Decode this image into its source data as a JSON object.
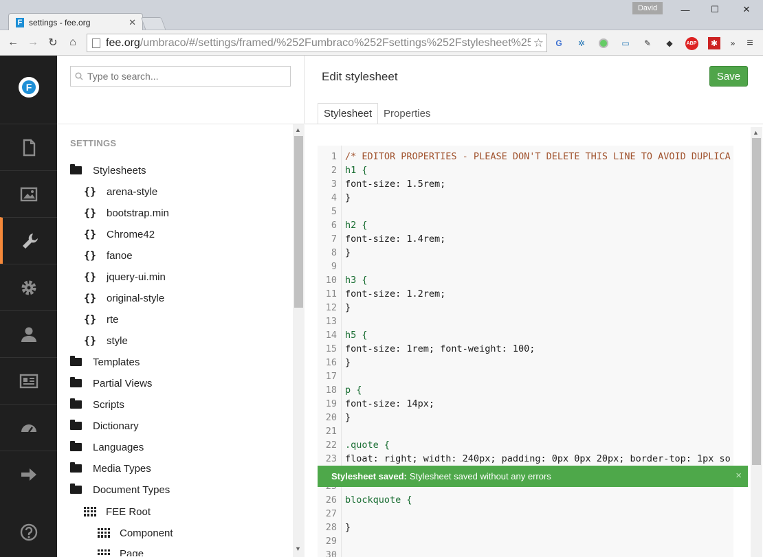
{
  "browser": {
    "tab_title": "settings - fee.org",
    "tab_favicon": "F",
    "user": "David",
    "url_host": "fee.org",
    "url_rest": "/umbraco/#/settings/framed/%252Fumbraco%252Fsettings%252Fstylesheet%252",
    "ext_abp": "ABP"
  },
  "rail": {
    "logo": "F",
    "items": [
      {
        "icon": "document-icon"
      },
      {
        "icon": "image-icon"
      },
      {
        "icon": "wrench-icon",
        "active": true
      },
      {
        "icon": "gear-icon"
      },
      {
        "icon": "user-icon"
      },
      {
        "icon": "id-card-icon"
      },
      {
        "icon": "gauge-icon"
      },
      {
        "icon": "arrow-right-icon"
      },
      {
        "icon": "help-icon"
      }
    ]
  },
  "tree": {
    "search_placeholder": "Type to search...",
    "heading": "SETTINGS",
    "stylesheets_label": "Stylesheets",
    "stylesheets": [
      "arena-style",
      "bootstrap.min",
      "Chrome42",
      "fanoe",
      "jquery-ui.min",
      "original-style",
      "rte",
      "style"
    ],
    "folders": [
      "Templates",
      "Partial Views",
      "Scripts",
      "Dictionary",
      "Languages",
      "Media Types",
      "Document Types"
    ],
    "doc_types": {
      "root": "FEE Root",
      "children": [
        "Component",
        "Page"
      ]
    }
  },
  "editor": {
    "title": "Edit stylesheet",
    "save_label": "Save",
    "tabs": [
      {
        "label": "Stylesheet",
        "active": true
      },
      {
        "label": "Properties",
        "active": false
      }
    ],
    "lines": [
      "/* EDITOR PROPERTIES - PLEASE DON'T DELETE THIS LINE TO AVOID DUPLICA",
      "h1 {",
      "font-size: 1.5rem;",
      "}",
      "",
      "h2 {",
      "font-size: 1.4rem;",
      "}",
      "",
      "h3 {",
      "font-size: 1.2rem;",
      "}",
      "",
      "h5 {",
      "font-size: 1rem; font-weight: 100;",
      "}",
      "",
      "p {",
      "font-size: 14px;",
      "}",
      "",
      ".quote {",
      "float: right; width: 240px; padding: 0px 0px 20px; border-top: 1px so",
      "",
      "",
      "blockquote {",
      "",
      "}",
      "",
      ""
    ]
  },
  "notification": {
    "title": "Stylesheet saved:",
    "message": "Stylesheet saved without any errors",
    "close": "×"
  }
}
